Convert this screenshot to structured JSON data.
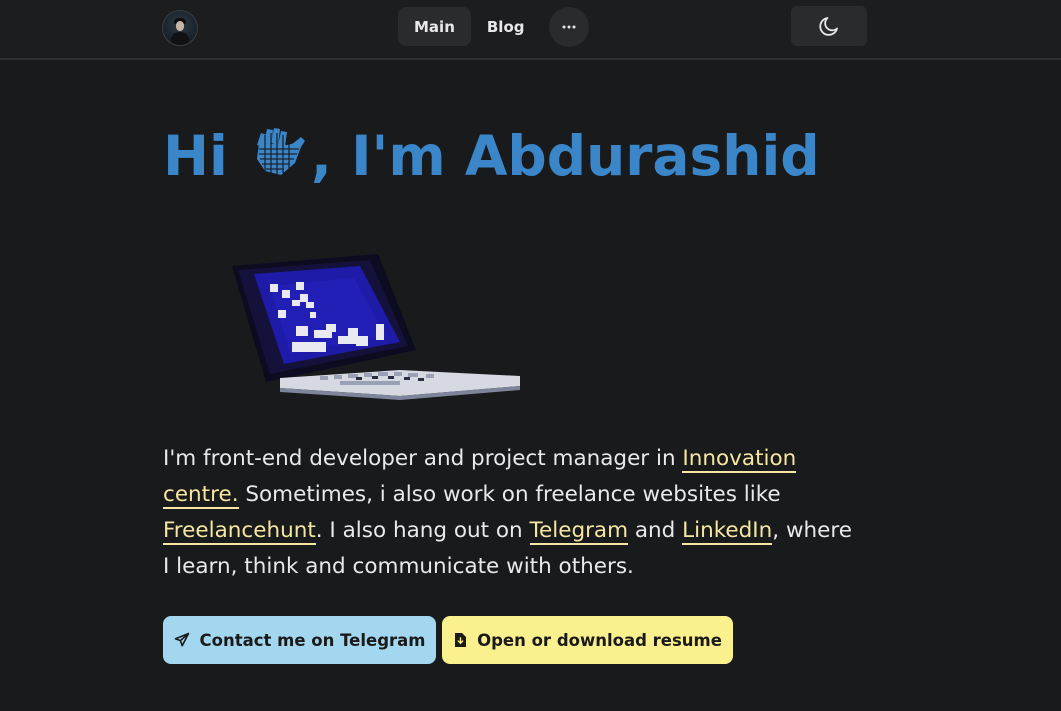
{
  "header": {
    "avatar_alt": "avatar",
    "nav": [
      {
        "label": "Main",
        "active": true
      },
      {
        "label": "Blog",
        "active": false
      }
    ],
    "more_label": "···",
    "theme_icon": "moon-icon"
  },
  "hero": {
    "greeting": "Hi",
    "wave_icon": "waving-hand-icon",
    "name_text": ", I'm Abdurashid",
    "illustration": "pixel-laptop-illustration"
  },
  "bio": {
    "part1": "I'm front-end developer and project manager in ",
    "link1": " Innovation centre.",
    "part2": "  Sometimes, i also work on freelance websites like ",
    "link2": "Freelancehunt",
    "part3": ". I also hang out on ",
    "link3": "Telegram",
    "part4": " and ",
    "link4": "LinkedIn",
    "part5": ", where I learn, think and communicate with others."
  },
  "actions": {
    "telegram_label": "Contact me on Telegram",
    "telegram_icon": "send-icon",
    "resume_label": "Open or download resume",
    "resume_icon": "file-download-icon"
  },
  "colors": {
    "background": "#191a1c",
    "header": "#1c1d1f",
    "title": "#3a86c9",
    "link": "#f5e7a1",
    "telegram_button": "#a3d7ef",
    "resume_button": "#faf08e"
  }
}
